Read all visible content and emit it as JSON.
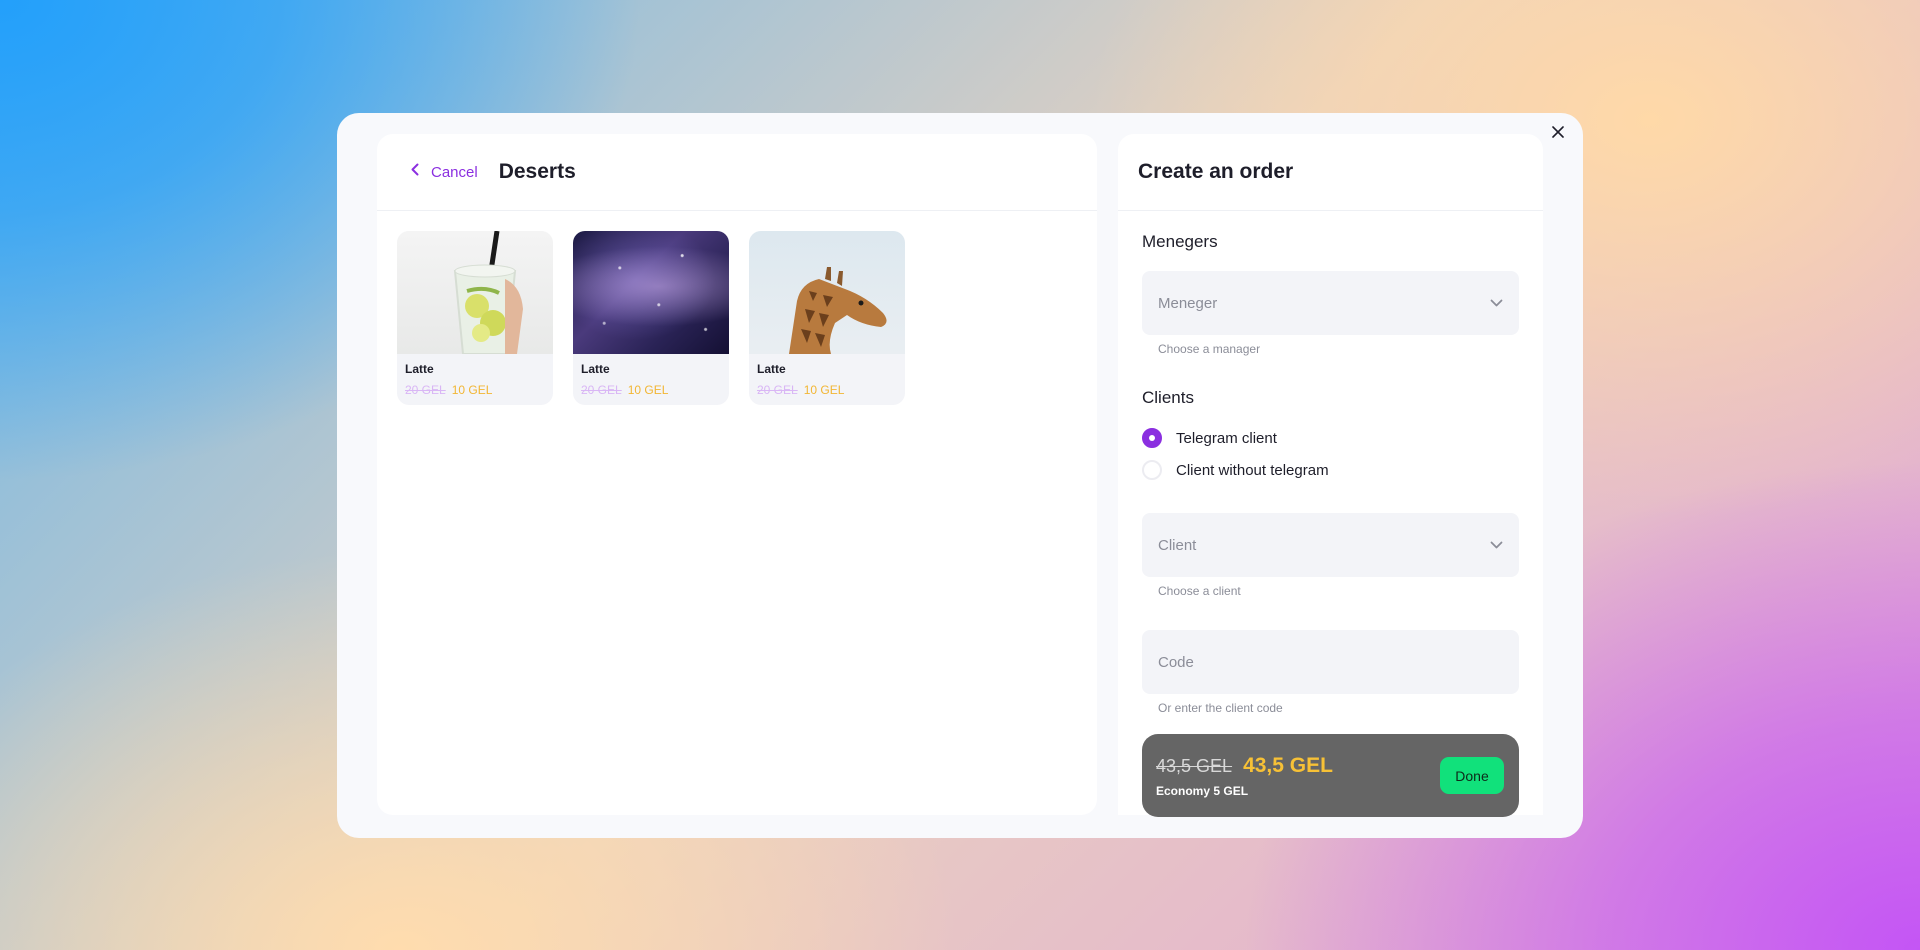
{
  "left": {
    "back_label": "Cancel",
    "title": "Deserts",
    "products": [
      {
        "name": "Latte",
        "old_price": "20 GEL",
        "new_price": "10 GEL",
        "image": "lemonade-photo"
      },
      {
        "name": "Latte",
        "old_price": "20 GEL",
        "new_price": "10 GEL",
        "image": "galaxy-photo"
      },
      {
        "name": "Latte",
        "old_price": "20 GEL",
        "new_price": "10 GEL",
        "image": "giraffe-photo"
      }
    ]
  },
  "right": {
    "title": "Create an order",
    "managers": {
      "section_title": "Menegers",
      "placeholder": "Meneger",
      "helper": "Choose a manager"
    },
    "clients": {
      "section_title": "Clients",
      "options": [
        {
          "label": "Telegram client",
          "checked": true
        },
        {
          "label": "Client without telegram",
          "checked": false
        }
      ],
      "placeholder": "Client",
      "helper": "Choose a client",
      "code_placeholder": "Code",
      "code_helper": "Or enter the client code"
    }
  },
  "summary": {
    "old_total": "43,5 GEL",
    "new_total": "43,5 GEL",
    "economy": "Economy 5 GEL",
    "done_label": "Done"
  },
  "colors": {
    "accent": "#8b2fe0",
    "done": "#11e17b",
    "price": "#f2b634"
  }
}
